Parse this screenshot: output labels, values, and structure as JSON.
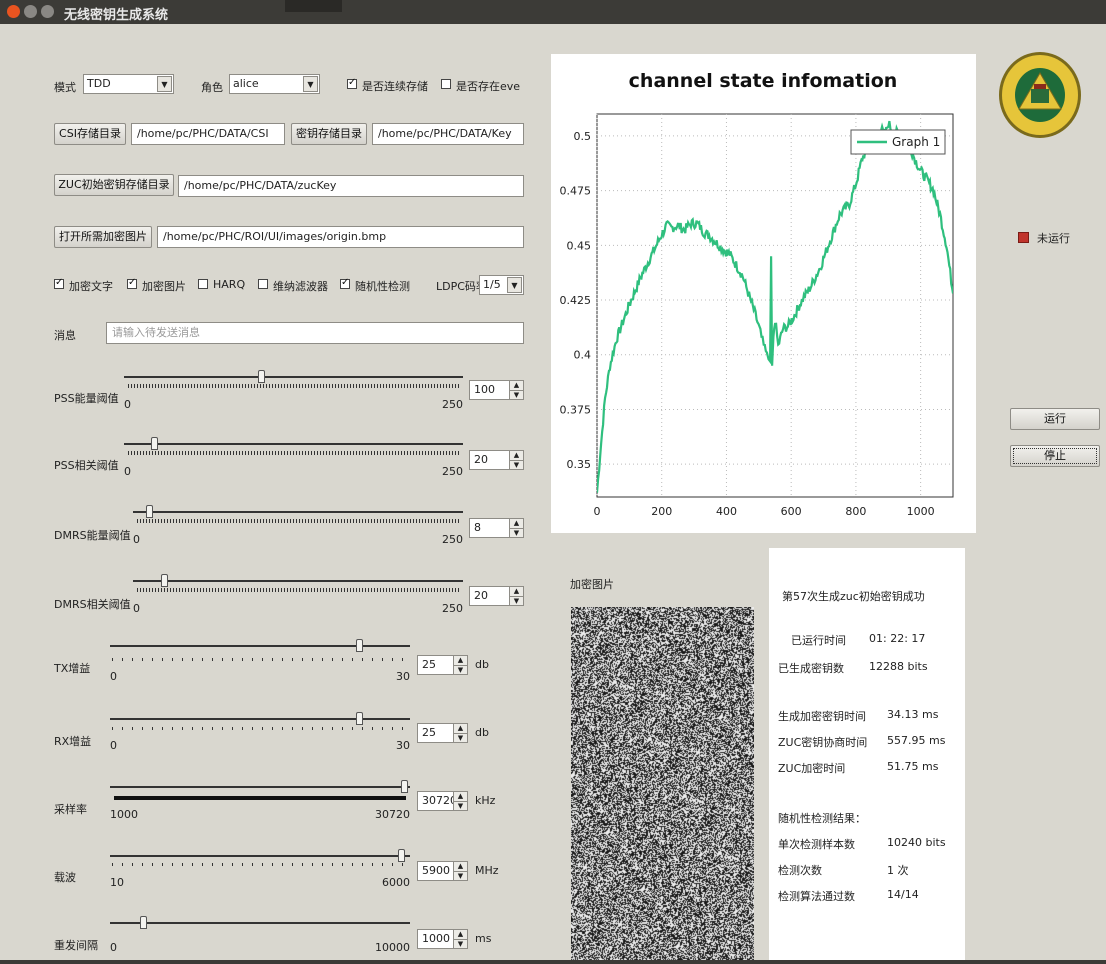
{
  "window": {
    "title": "无线密钥生成系统"
  },
  "mode": {
    "label": "模式",
    "value": "TDD"
  },
  "role": {
    "label": "角色",
    "value": "alice"
  },
  "checks_top": [
    {
      "label": "是否连续存储",
      "checked": true
    },
    {
      "label": "是否存在eve",
      "checked": false
    }
  ],
  "paths": {
    "csi_btn": "CSI存储目录",
    "csi_path": "/home/pc/PHC/DATA/CSI",
    "key_btn": "密钥存储目录",
    "key_path": "/home/pc/PHC/DATA/Key",
    "zuc_btn": "ZUC初始密钥存储目录",
    "zuc_path": "/home/pc/PHC/DATA/zucKey",
    "img_btn": "打开所需加密图片",
    "img_path": "/home/pc/PHC/ROI/UI/images/origin.bmp"
  },
  "options": [
    {
      "label": "加密文字",
      "checked": true
    },
    {
      "label": "加密图片",
      "checked": true
    },
    {
      "label": "HARQ",
      "checked": false
    },
    {
      "label": "维纳滤波器",
      "checked": false
    },
    {
      "label": "随机性检测",
      "checked": true
    }
  ],
  "ldpc": {
    "label": "LDPC码率",
    "value": "1/5"
  },
  "message": {
    "label": "消息",
    "placeholder": "请输入待发送消息"
  },
  "sliders": [
    {
      "label": "PSS能量阈值",
      "min": "0",
      "max": "250",
      "value": "100",
      "unit": ""
    },
    {
      "label": "PSS相关阈值",
      "min": "0",
      "max": "250",
      "value": "20",
      "unit": ""
    },
    {
      "label": "DMRS能量阈值",
      "min": "0",
      "max": "250",
      "value": "8",
      "unit": ""
    },
    {
      "label": "DMRS相关阈值",
      "min": "0",
      "max": "250",
      "value": "20",
      "unit": ""
    },
    {
      "label": "TX增益",
      "min": "0",
      "max": "30",
      "value": "25",
      "unit": "db"
    },
    {
      "label": "RX增益",
      "min": "0",
      "max": "30",
      "value": "25",
      "unit": "db"
    },
    {
      "label": "采样率",
      "min": "1000",
      "max": "30720",
      "value": "30720",
      "unit": "kHz"
    },
    {
      "label": "载波",
      "min": "10",
      "max": "6000",
      "value": "5900",
      "unit": "MHz"
    },
    {
      "label": "重发间隔",
      "min": "0",
      "max": "10000",
      "value": "1000",
      "unit": "ms"
    }
  ],
  "status": {
    "led_label": "未运行",
    "led_color": "#c0342c"
  },
  "buttons": {
    "run": "运行",
    "stop": "停止"
  },
  "image_panel": {
    "label": "加密图片"
  },
  "info": {
    "headline": "第57次生成zuc初始密钥成功",
    "rows": [
      {
        "k": "已运行时间",
        "v": "01: 22: 17"
      },
      {
        "k": "已生成密钥数",
        "v": "12288 bits"
      },
      {
        "k": "生成加密密钥时间",
        "v": "34.13 ms"
      },
      {
        "k": "ZUC密钥协商时间",
        "v": "557.95 ms"
      },
      {
        "k": "ZUC加密时间",
        "v": "51.75 ms"
      },
      {
        "k": "随机性检测结果：",
        "v": ""
      },
      {
        "k": "单次检测样本数",
        "v": "10240 bits"
      },
      {
        "k": "检测次数",
        "v": "1 次"
      },
      {
        "k": "检测算法通过数",
        "v": "14/14"
      }
    ]
  },
  "chart_data": {
    "type": "line",
    "title": "channel state infomation",
    "legend": "top-right",
    "xlim": [
      0,
      1100
    ],
    "ylim": [
      0.335,
      0.51
    ],
    "xticks": [
      "0",
      "200",
      "400",
      "600",
      "800",
      "1000"
    ],
    "yticks": [
      "0.35",
      "0.375",
      "0.4",
      "0.425",
      "0.45",
      "0.475",
      "0.5"
    ],
    "grid": true,
    "series": [
      {
        "name": "Graph 1",
        "color": "#2fbf7e",
        "x": [
          0,
          10,
          25,
          40,
          60,
          80,
          100,
          120,
          140,
          160,
          180,
          200,
          215,
          230,
          250,
          270,
          290,
          310,
          330,
          350,
          370,
          390,
          410,
          430,
          450,
          470,
          490,
          505,
          515,
          525,
          530,
          535,
          538,
          541,
          545,
          550,
          560,
          575,
          590,
          610,
          630,
          660,
          690,
          720,
          750,
          780,
          800,
          820,
          840,
          860,
          875,
          890,
          900,
          910,
          920,
          940,
          960,
          980,
          1000,
          1020,
          1040,
          1060,
          1080,
          1100
        ],
        "y": [
          0.337,
          0.355,
          0.38,
          0.395,
          0.407,
          0.415,
          0.423,
          0.43,
          0.437,
          0.443,
          0.449,
          0.455,
          0.459,
          0.458,
          0.459,
          0.457,
          0.46,
          0.46,
          0.456,
          0.454,
          0.451,
          0.448,
          0.446,
          0.441,
          0.436,
          0.427,
          0.418,
          0.41,
          0.404,
          0.401,
          0.398,
          0.397,
          0.445,
          0.395,
          0.408,
          0.416,
          0.404,
          0.412,
          0.413,
          0.418,
          0.424,
          0.431,
          0.44,
          0.452,
          0.464,
          0.469,
          0.478,
          0.49,
          0.495,
          0.498,
          0.504,
          0.5,
          0.506,
          0.503,
          0.502,
          0.5,
          0.498,
          0.49,
          0.484,
          0.48,
          0.475,
          0.464,
          0.45,
          0.428
        ]
      }
    ]
  }
}
